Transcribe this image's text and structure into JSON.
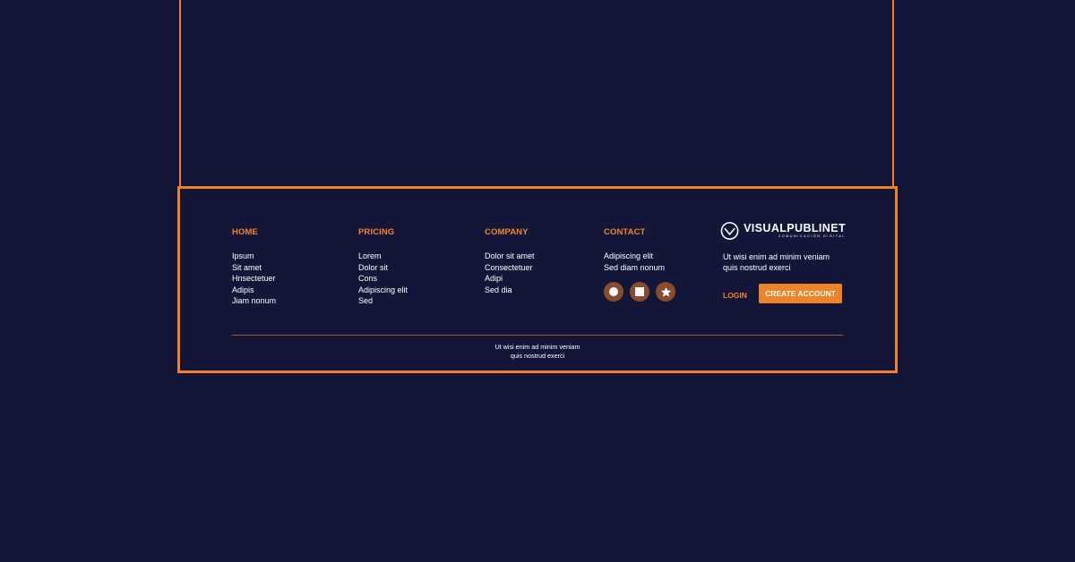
{
  "colors": {
    "background": "#131639",
    "accent": "#f08328",
    "social_button": "#8a4a2c",
    "text": "#ffffff"
  },
  "footer": {
    "columns": {
      "home": {
        "heading": "HOME",
        "links": [
          "Ipsum",
          "Sit amet",
          "Hnsectetuer",
          "Adipis",
          "Jiam nonum"
        ]
      },
      "pricing": {
        "heading": "PRICING",
        "links": [
          "Lorem",
          "Dolor sit",
          "Cons",
          "Adipiscing elit",
          "Sed"
        ]
      },
      "company": {
        "heading": "COMPANY",
        "links": [
          "Dolor sit amet",
          "Consectetuer",
          "Adipi",
          "Sed dia"
        ]
      },
      "contact": {
        "heading": "CONTACT",
        "links": [
          "Adipiscing elit",
          "Sed diam nonum"
        ]
      }
    },
    "social_icons": [
      "circle-icon",
      "square-icon",
      "star-icon"
    ],
    "brand": {
      "name": "VISUALPUBLINET",
      "tagline": "COMUNICACIÓN DIGITAL",
      "blurb_line1": "Ut wisi enim ad minim veniam",
      "blurb_line2": "quis nostrud exerci",
      "login_label": "LOGIN",
      "create_account_label": "CREATE ACCOUNT"
    },
    "bottom_text_line1": "Ut wisi enim ad minim veniam",
    "bottom_text_line2": "quis nostrud exerci"
  }
}
